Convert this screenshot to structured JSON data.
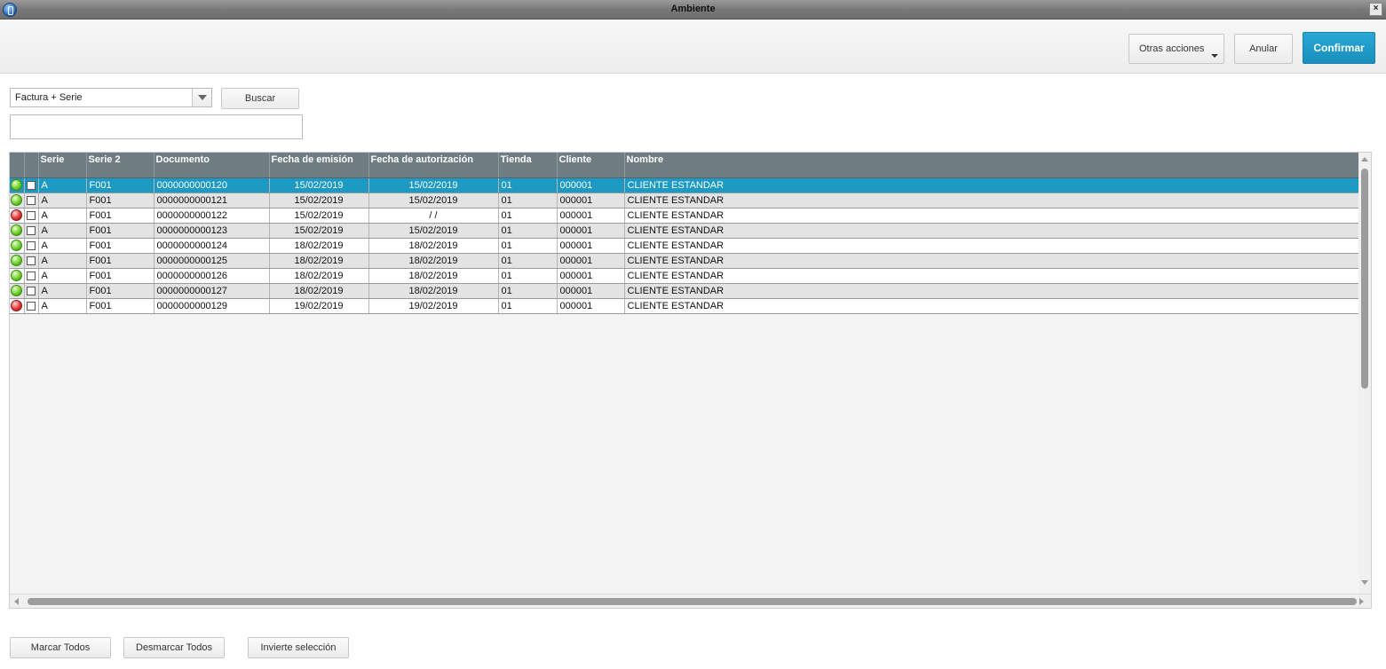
{
  "window": {
    "title": "Ambiente",
    "close_label": "×"
  },
  "toolbar": {
    "other_actions_label": "Otras acciones",
    "cancel_label": "Anular",
    "confirm_label": "Confirmar"
  },
  "search": {
    "order_selected": "Factura + Serie",
    "search_button": "Buscar",
    "query_value": ""
  },
  "table": {
    "columns": [
      "",
      "",
      "Serie",
      "Serie 2",
      "Documento",
      "Fecha de emisión",
      "Fecha de autorización",
      "Tienda",
      "Cliente",
      "Nombre"
    ],
    "rows": [
      {
        "status": "green",
        "serie": "A",
        "serie2": "F001",
        "documento": "0000000000120",
        "fecha_emision": "15/02/2019",
        "fecha_autorizacion": "15/02/2019",
        "tienda": "01",
        "cliente": "000001",
        "nombre": "CLIENTE ESTANDAR"
      },
      {
        "status": "green",
        "serie": "A",
        "serie2": "F001",
        "documento": "0000000000121",
        "fecha_emision": "15/02/2019",
        "fecha_autorizacion": "15/02/2019",
        "tienda": "01",
        "cliente": "000001",
        "nombre": "CLIENTE ESTANDAR"
      },
      {
        "status": "red",
        "serie": "A",
        "serie2": "F001",
        "documento": "0000000000122",
        "fecha_emision": "15/02/2019",
        "fecha_autorizacion": "/ /",
        "tienda": "01",
        "cliente": "000001",
        "nombre": "CLIENTE ESTANDAR"
      },
      {
        "status": "green",
        "serie": "A",
        "serie2": "F001",
        "documento": "0000000000123",
        "fecha_emision": "15/02/2019",
        "fecha_autorizacion": "15/02/2019",
        "tienda": "01",
        "cliente": "000001",
        "nombre": "CLIENTE ESTANDAR"
      },
      {
        "status": "green",
        "serie": "A",
        "serie2": "F001",
        "documento": "0000000000124",
        "fecha_emision": "18/02/2019",
        "fecha_autorizacion": "18/02/2019",
        "tienda": "01",
        "cliente": "000001",
        "nombre": "CLIENTE ESTANDAR"
      },
      {
        "status": "green",
        "serie": "A",
        "serie2": "F001",
        "documento": "0000000000125",
        "fecha_emision": "18/02/2019",
        "fecha_autorizacion": "18/02/2019",
        "tienda": "01",
        "cliente": "000001",
        "nombre": "CLIENTE ESTANDAR"
      },
      {
        "status": "green",
        "serie": "A",
        "serie2": "F001",
        "documento": "0000000000126",
        "fecha_emision": "18/02/2019",
        "fecha_autorizacion": "18/02/2019",
        "tienda": "01",
        "cliente": "000001",
        "nombre": "CLIENTE ESTANDAR"
      },
      {
        "status": "green",
        "serie": "A",
        "serie2": "F001",
        "documento": "0000000000127",
        "fecha_emision": "18/02/2019",
        "fecha_autorizacion": "18/02/2019",
        "tienda": "01",
        "cliente": "000001",
        "nombre": "CLIENTE ESTANDAR"
      },
      {
        "status": "red",
        "serie": "A",
        "serie2": "F001",
        "documento": "0000000000129",
        "fecha_emision": "19/02/2019",
        "fecha_autorizacion": "19/02/2019",
        "tienda": "01",
        "cliente": "000001",
        "nombre": "CLIENTE ESTANDAR"
      }
    ]
  },
  "footer": {
    "mark_all": "Marcar Todos",
    "unmark_all": "Desmarcar Todos",
    "invert": "Invierte selección"
  },
  "colors": {
    "accent": "#1c9ac3",
    "header_bg": "#6f7c82",
    "status_green": "#6fcf2a",
    "status_red": "#e33535"
  }
}
